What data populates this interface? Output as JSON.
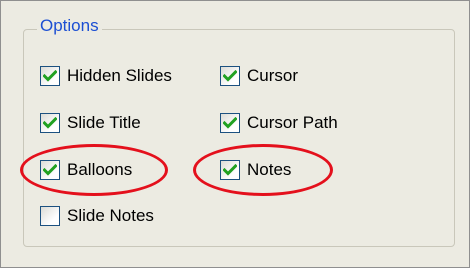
{
  "options": {
    "title": "Options",
    "items": [
      {
        "label": "Hidden Slides",
        "checked": true
      },
      {
        "label": "Cursor",
        "checked": true
      },
      {
        "label": "Slide Title",
        "checked": true
      },
      {
        "label": "Cursor Path",
        "checked": true
      },
      {
        "label": "Balloons",
        "checked": true,
        "highlighted": true
      },
      {
        "label": "Notes",
        "checked": true,
        "highlighted": true
      },
      {
        "label": "Slide Notes",
        "checked": false
      }
    ]
  },
  "colors": {
    "group_title": "#1c4fd3",
    "checkmark": "#21a121",
    "checkbox_border": "#1c5180",
    "highlight_ring": "#e4101c",
    "panel_background": "#ecebe2"
  },
  "icons": {
    "checkmark": "checkmark-icon"
  }
}
